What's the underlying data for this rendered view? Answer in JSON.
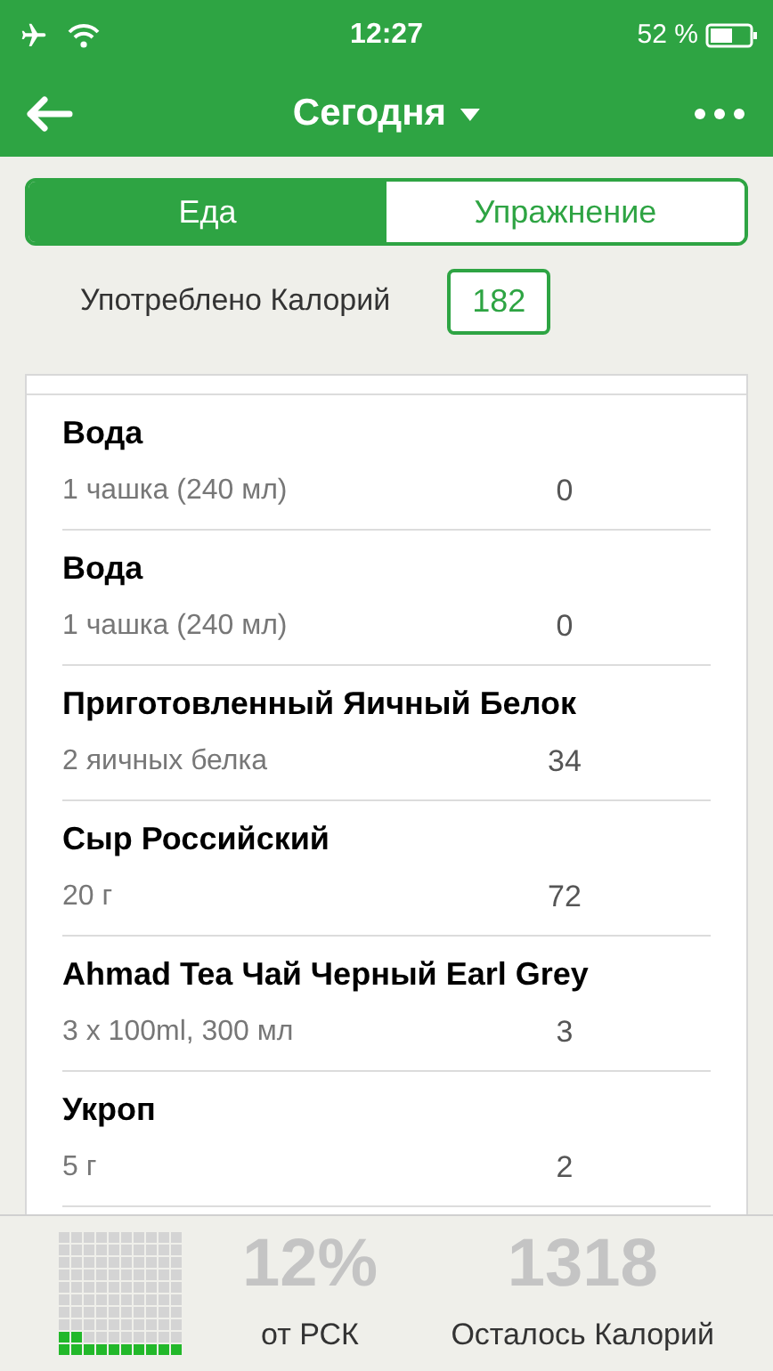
{
  "status_bar": {
    "time": "12:27",
    "battery_text": "52 %"
  },
  "nav": {
    "title": "Сегодня"
  },
  "tabs": [
    {
      "label": "Еда",
      "selected": true
    },
    {
      "label": "Упражнение",
      "selected": false
    }
  ],
  "consumed": {
    "label": "Употреблено Калорий",
    "value": "182"
  },
  "items": [
    {
      "name": "Вода",
      "serving": "1 чашка (240 мл)",
      "calories": "0"
    },
    {
      "name": "Вода",
      "serving": "1 чашка (240 мл)",
      "calories": "0"
    },
    {
      "name": "Приготовленный Яичный Белок",
      "serving": "2 яичных белка",
      "calories": "34"
    },
    {
      "name": "Сыр Российский",
      "serving": "20 г",
      "calories": "72"
    },
    {
      "name": "Ahmad Tea Чай Черный Earl Grey",
      "serving": "3 x 100ml, 300 мл",
      "calories": "3"
    },
    {
      "name": "Укроп",
      "serving": "5 г",
      "calories": "2"
    }
  ],
  "footer": {
    "progress": {
      "level": 0.12
    },
    "percent": "12%",
    "percent_label": "от РСК",
    "remaining": "1318",
    "remaining_label": "Осталось Калорий"
  }
}
